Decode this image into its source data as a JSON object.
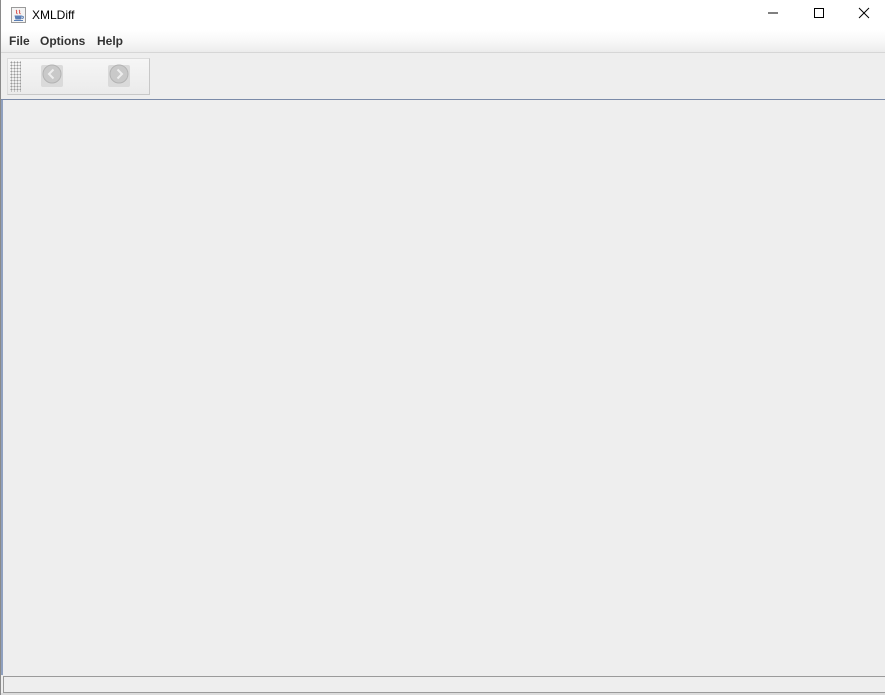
{
  "window": {
    "title": "XMLDiff",
    "app_icon": "java-cup-icon",
    "controls": {
      "minimize": "minimize-icon",
      "maximize": "maximize-icon",
      "close": "close-icon"
    }
  },
  "menubar": {
    "items": [
      {
        "label": "File"
      },
      {
        "label": "Options"
      },
      {
        "label": "Help"
      }
    ]
  },
  "toolbar": {
    "buttons": [
      {
        "icon": "back-arrow-icon",
        "enabled": false
      },
      {
        "icon": "forward-arrow-icon",
        "enabled": false
      }
    ]
  },
  "statusbar": {
    "text": ""
  },
  "colors": {
    "window_bg": "#eeeeee",
    "accent_border": "#8fa0bf",
    "disabled_button": "#dadada"
  }
}
